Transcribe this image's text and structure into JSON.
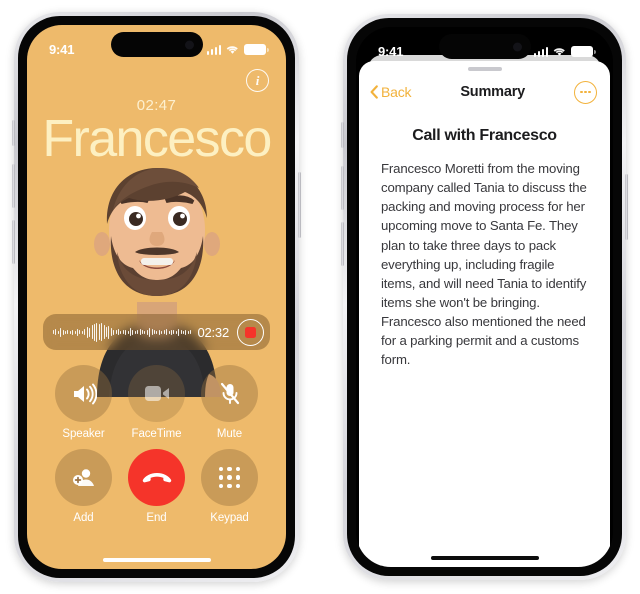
{
  "colors": {
    "call_background": "#eeba6b",
    "name_text": "#fdf0c2",
    "end_red": "#f5342a",
    "accent_gold": "#f2b23c",
    "sheet_white": "#ffffff"
  },
  "call_phone": {
    "status_bar": {
      "time": "9:41",
      "cellular_icon": "cellular-bars-icon",
      "wifi_icon": "wifi-icon",
      "battery_icon": "battery-icon"
    },
    "info_button": {
      "icon": "info-circle-icon",
      "label": "i"
    },
    "call_timer": "02:47",
    "caller_name": "Francesco",
    "avatar": "memoji-avatar",
    "recording": {
      "icon": "waveform-icon",
      "elapsed": "02:32",
      "stop_button": "stop-recording-button",
      "waveform_heights": [
        4,
        6,
        3,
        9,
        5,
        3,
        4,
        3,
        5,
        3,
        7,
        4,
        3,
        6,
        11,
        9,
        14,
        17,
        19,
        16,
        18,
        14,
        10,
        13,
        8,
        5,
        4,
        6,
        3,
        4,
        5,
        3,
        8,
        5,
        3,
        4,
        6,
        4,
        3,
        5,
        9,
        6,
        4,
        3,
        5,
        3,
        4,
        6,
        3,
        5,
        4,
        3,
        7,
        4,
        3,
        5,
        3,
        4
      ]
    },
    "controls": [
      {
        "label": "Speaker",
        "icon": "speaker-icon",
        "name": "speaker-button",
        "state": "active"
      },
      {
        "label": "FaceTime",
        "icon": "facetime-video-icon",
        "name": "facetime-button",
        "state": "disabled"
      },
      {
        "label": "Mute",
        "icon": "microphone-muted-icon",
        "name": "mute-button",
        "state": "active"
      },
      {
        "label": "Add",
        "icon": "add-contact-icon",
        "name": "add-call-button",
        "state": "active"
      },
      {
        "label": "End",
        "icon": "end-call-handset-icon",
        "name": "end-call-button",
        "state": "end"
      },
      {
        "label": "Keypad",
        "icon": "keypad-dots-icon",
        "name": "keypad-button",
        "state": "active"
      }
    ],
    "home_indicator": "home-indicator"
  },
  "summary_phone": {
    "status_bar": {
      "time": "9:41",
      "cellular_icon": "cellular-bars-icon",
      "wifi_icon": "wifi-icon",
      "battery_icon": "battery-icon"
    },
    "nav": {
      "back_label": "Back",
      "back_icon": "chevron-left-icon",
      "title": "Summary",
      "more_icon": "more-ellipsis-icon",
      "grabber": "sheet-grabber"
    },
    "heading": "Call with Francesco",
    "body": "Francesco Moretti from the moving company called Tania to discuss the packing and moving process for her upcoming move to Santa Fe. They plan to take three days to pack everything up, including fragile items, and will need Tania to identify items she won't be bringing. Francesco also mentioned the need for a parking permit and a customs form.",
    "home_indicator": "home-indicator"
  }
}
